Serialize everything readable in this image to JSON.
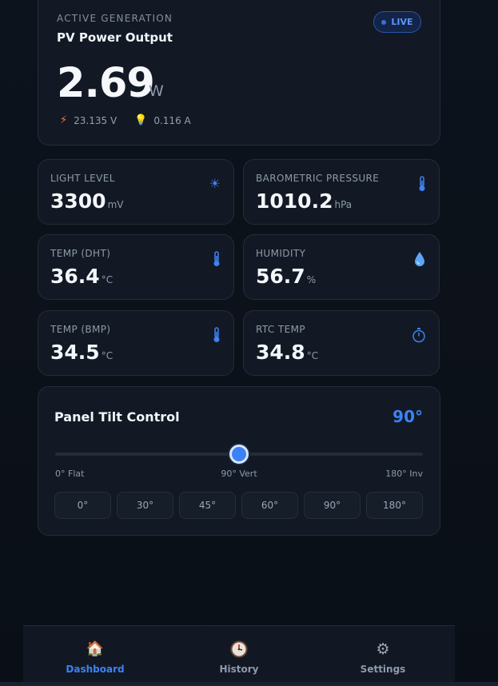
{
  "hero": {
    "eyebrow": "ACTIVE GENERATION",
    "title": "PV Power Output",
    "live": "LIVE",
    "value": "2.69",
    "unit": "W",
    "voltage": "23.135  V",
    "current": "0.116  A"
  },
  "metrics": [
    {
      "label": "LIGHT LEVEL",
      "value": "3300",
      "unit": "mV",
      "icon": "sun-icon"
    },
    {
      "label": "BAROMETRIC PRESSURE",
      "value": "1010.2",
      "unit": "hPa",
      "icon": "thermometer-icon"
    },
    {
      "label": "TEMP (DHT)",
      "value": "36.4",
      "unit": "°C",
      "icon": "thermometer-icon"
    },
    {
      "label": "HUMIDITY",
      "value": "56.7",
      "unit": "%",
      "icon": "droplet-icon"
    },
    {
      "label": "TEMP (BMP)",
      "value": "34.5",
      "unit": "°C",
      "icon": "thermometer-icon"
    },
    {
      "label": "RTC TEMP",
      "value": "34.8",
      "unit": "°C",
      "icon": "stopwatch-icon"
    }
  ],
  "tilt": {
    "title": "Panel Tilt Control",
    "angle": "90°",
    "slider_value": 90,
    "slider_max": 180,
    "tick_min": "0° Flat",
    "tick_mid": "90° Vert",
    "tick_max": "180° Inv",
    "presets": [
      "0°",
      "30°",
      "45°",
      "60°",
      "90°",
      "180°"
    ]
  },
  "nav": {
    "items": [
      {
        "label": "Dashboard",
        "icon": "house-icon",
        "active": true
      },
      {
        "label": "History",
        "icon": "clock-icon",
        "active": false
      },
      {
        "label": "Settings",
        "icon": "gear-icon",
        "active": false
      }
    ]
  },
  "colors": {
    "accent": "#3b82f6",
    "background": "#0c1119",
    "card": "#121924"
  }
}
